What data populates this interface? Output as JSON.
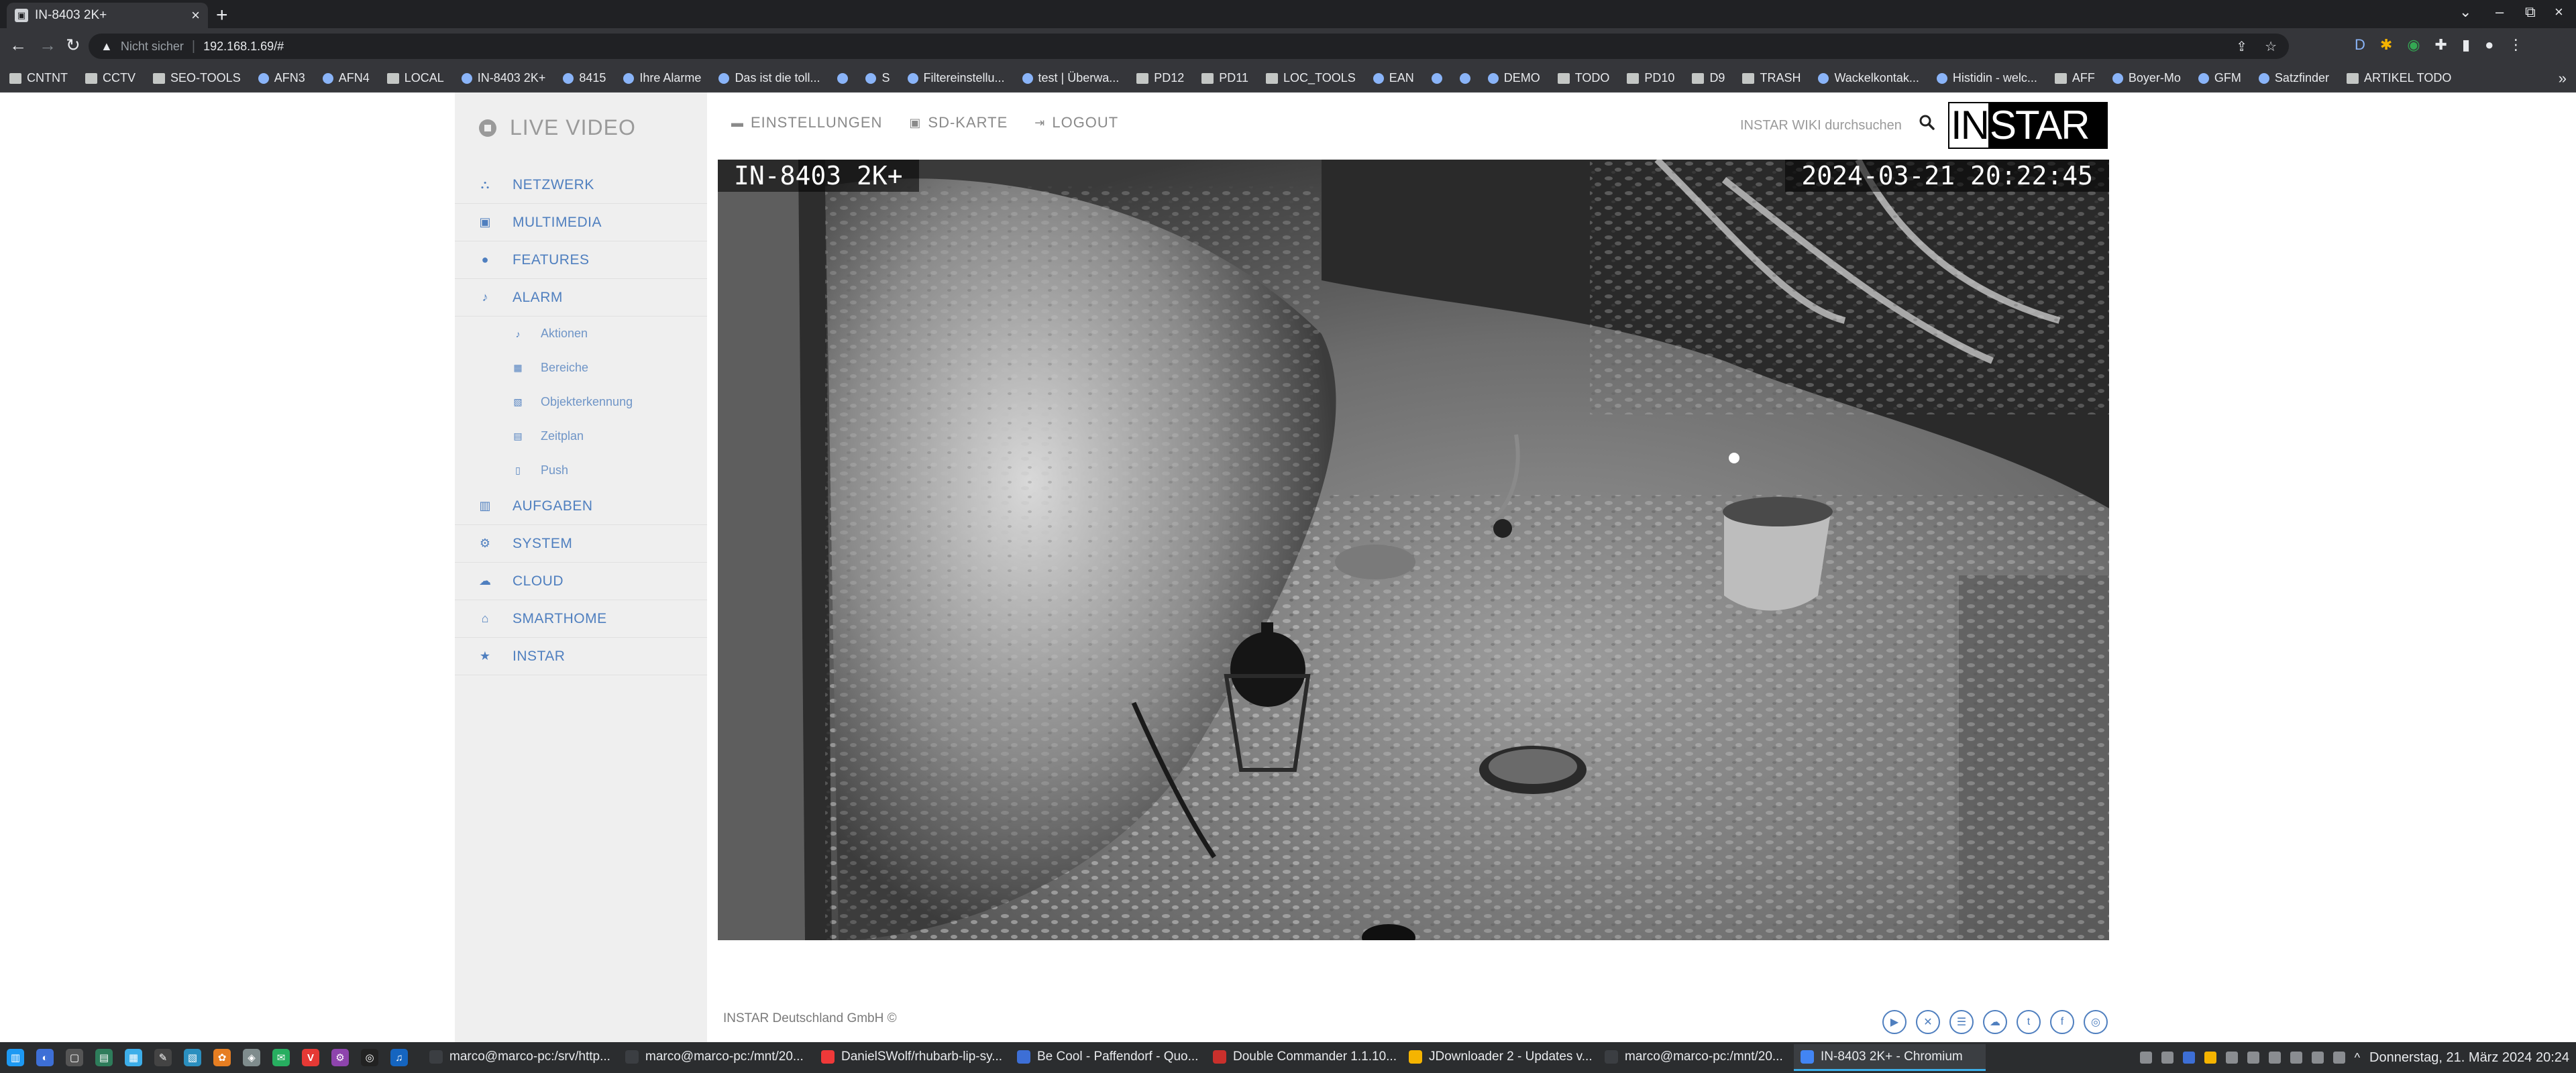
{
  "browser": {
    "tab_title": "IN-8403 2K+",
    "tab_favicon": "camera-favicon",
    "address_security": "Nicht sicher",
    "address_url": "192.168.1.69/#",
    "bookmarks": [
      "CNTNT",
      "CCTV",
      "SEO-TOOLS",
      "AFN3",
      "AFN4",
      "LOCAL",
      "IN-8403 2K+",
      "8415",
      "Ihre Alarme",
      "Das ist die toll...",
      "",
      "S",
      "Filtereinstellu...",
      "test | Überwa...",
      "PD12",
      "PD11",
      "LOC_TOOLS",
      "EAN",
      "",
      "",
      "DEMO",
      "TODO",
      "PD10",
      "D9",
      "TRASH",
      "Wackelkontak...",
      "Histidin - welc...",
      "AFF",
      "Boyer-Mo",
      "GFM",
      "Satzfinder",
      "ARTIKEL TODO"
    ]
  },
  "app": {
    "brand_title": "LIVE VIDEO",
    "menu": [
      {
        "label": "NETZWERK",
        "icon": "network-icon"
      },
      {
        "label": "MULTIMEDIA",
        "icon": "image-icon"
      },
      {
        "label": "FEATURES",
        "icon": "circle-icon"
      },
      {
        "label": "ALARM",
        "icon": "bell-icon"
      }
    ],
    "alarm_sub": [
      {
        "label": "Aktionen",
        "icon": "bell-icon"
      },
      {
        "label": "Bereiche",
        "icon": "grid-icon"
      },
      {
        "label": "Objekterkennung",
        "icon": "object-detect-icon"
      },
      {
        "label": "Zeitplan",
        "icon": "calendar-icon"
      },
      {
        "label": "Push",
        "icon": "phone-icon"
      }
    ],
    "menu2": [
      {
        "label": "AUFGABEN",
        "icon": "film-icon"
      },
      {
        "label": "SYSTEM",
        "icon": "gear-icon"
      },
      {
        "label": "CLOUD",
        "icon": "cloud-icon"
      },
      {
        "label": "SMARTHOME",
        "icon": "home-icon"
      },
      {
        "label": "INSTAR",
        "icon": "star-icon"
      }
    ],
    "topnav": [
      {
        "label": "EINSTELLUNGEN",
        "icon": "settings-icon"
      },
      {
        "label": "SD-KARTE",
        "icon": "image-icon"
      },
      {
        "label": "LOGOUT",
        "icon": "logout-icon"
      }
    ],
    "search_placeholder": "INSTAR WIKI durchsuchen",
    "logo_left": "IN",
    "logo_right": "STAR",
    "video_label": "IN-8403 2K+",
    "video_timestamp": "2024-03-21 20:22:45",
    "footer": "INSTAR Deutschland GmbH ©",
    "social": [
      "youtube-icon",
      "xing-icon",
      "forum-icon",
      "cloud-icon",
      "twitter-icon",
      "facebook-icon",
      "instagram-icon"
    ],
    "accent_color": "#4f7fbf"
  },
  "taskbar": {
    "tasks": [
      {
        "label": "marco@marco-pc:/srv/http...",
        "color": "#3b3e42",
        "active": false
      },
      {
        "label": "marco@marco-pc:/mnt/20...",
        "color": "#3b3e42",
        "active": false
      },
      {
        "label": "DanielSWolf/rhubarb-lip-sy...",
        "color": "#ef3939",
        "active": false
      },
      {
        "label": "Be Cool - Paffendorf - Quo...",
        "color": "#3d6fd6",
        "active": false
      },
      {
        "label": "Double Commander 1.1.10...",
        "color": "#c9302c",
        "active": false
      },
      {
        "label": "JDownloader 2 - Updates v...",
        "color": "#f5b400",
        "active": false
      },
      {
        "label": "marco@marco-pc:/mnt/20...",
        "color": "#3b3e42",
        "active": false
      },
      {
        "label": "IN-8403 2K+ - Chromium",
        "color": "#4285f4",
        "active": true
      }
    ],
    "clock": "Donnerstag, 21. März 2024  20:24"
  }
}
